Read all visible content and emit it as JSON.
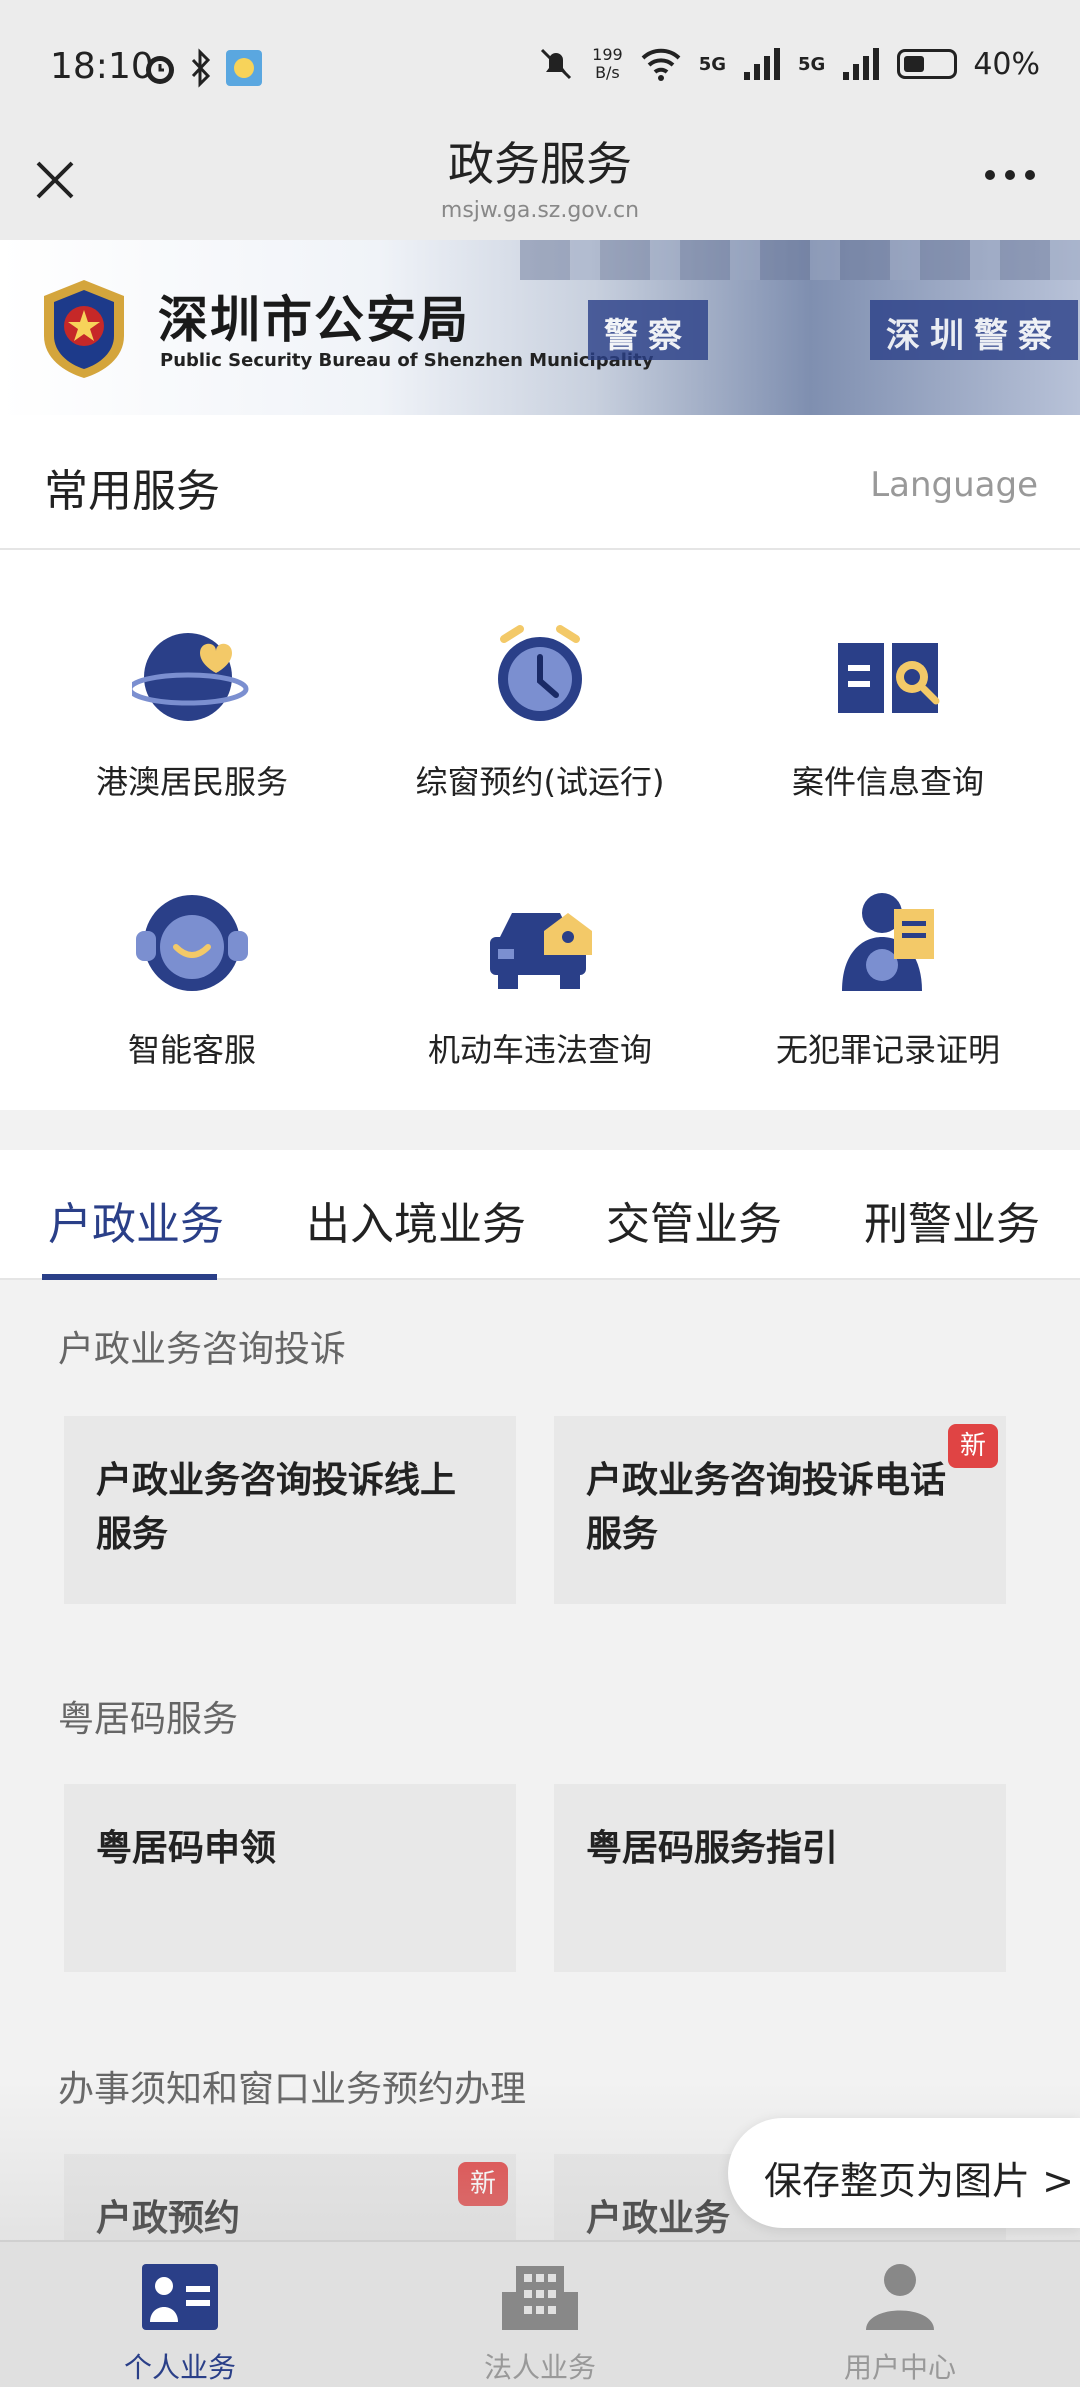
{
  "status_bar": {
    "time": "18:10",
    "net_speed_top": "199",
    "net_speed_bottom": "B/s",
    "signal1": "5G",
    "signal2": "5G",
    "battery": "40%"
  },
  "titlebar": {
    "title": "政务服务",
    "url": "msjw.ga.sz.gov.cn"
  },
  "banner": {
    "title_cn": "深圳市公安局",
    "title_en": "Public Security Bureau of Shenzhen Municipality",
    "plate1": "警察",
    "plate2": "深圳警察"
  },
  "common_services": {
    "heading": "常用服务",
    "language_label": "Language",
    "items": [
      {
        "label": "港澳居民服务",
        "icon": "globe-heart-icon"
      },
      {
        "label": "综窗预约(试运行)",
        "icon": "alarm-clock-icon"
      },
      {
        "label": "案件信息查询",
        "icon": "book-search-icon"
      },
      {
        "label": "智能客服",
        "icon": "robot-icon"
      },
      {
        "label": "机动车违法查询",
        "icon": "car-house-icon"
      },
      {
        "label": "无犯罪记录证明",
        "icon": "person-document-icon"
      }
    ]
  },
  "tabs": [
    {
      "label": "户政业务",
      "active": true
    },
    {
      "label": "出入境业务",
      "active": false
    },
    {
      "label": "交管业务",
      "active": false
    },
    {
      "label": "刑警业务",
      "active": false
    }
  ],
  "sections": [
    {
      "title": "户政业务咨询投诉",
      "tiles": [
        {
          "label": "户政业务咨询投诉线上服务",
          "badge": ""
        },
        {
          "label": "户政业务咨询投诉电话服务",
          "badge": "新"
        }
      ]
    },
    {
      "title": "粤居码服务",
      "tiles": [
        {
          "label": "粤居码申领",
          "badge": ""
        },
        {
          "label": "粤居码服务指引",
          "badge": ""
        }
      ]
    },
    {
      "title": "办事须知和窗口业务预约办理",
      "tiles": [
        {
          "label": "户政预约",
          "badge": "新"
        },
        {
          "label": "户政业务",
          "badge": ""
        }
      ]
    }
  ],
  "save_pill": "保存整页为图片 >",
  "bottom_nav": [
    {
      "label": "个人业务",
      "active": true,
      "icon": "id-card-icon"
    },
    {
      "label": "法人业务",
      "active": false,
      "icon": "building-icon"
    },
    {
      "label": "用户中心",
      "active": false,
      "icon": "user-icon"
    }
  ],
  "colors": {
    "brand_blue": "#2a3f88",
    "accent_gold": "#f3c968",
    "badge_red": "#e04444"
  }
}
